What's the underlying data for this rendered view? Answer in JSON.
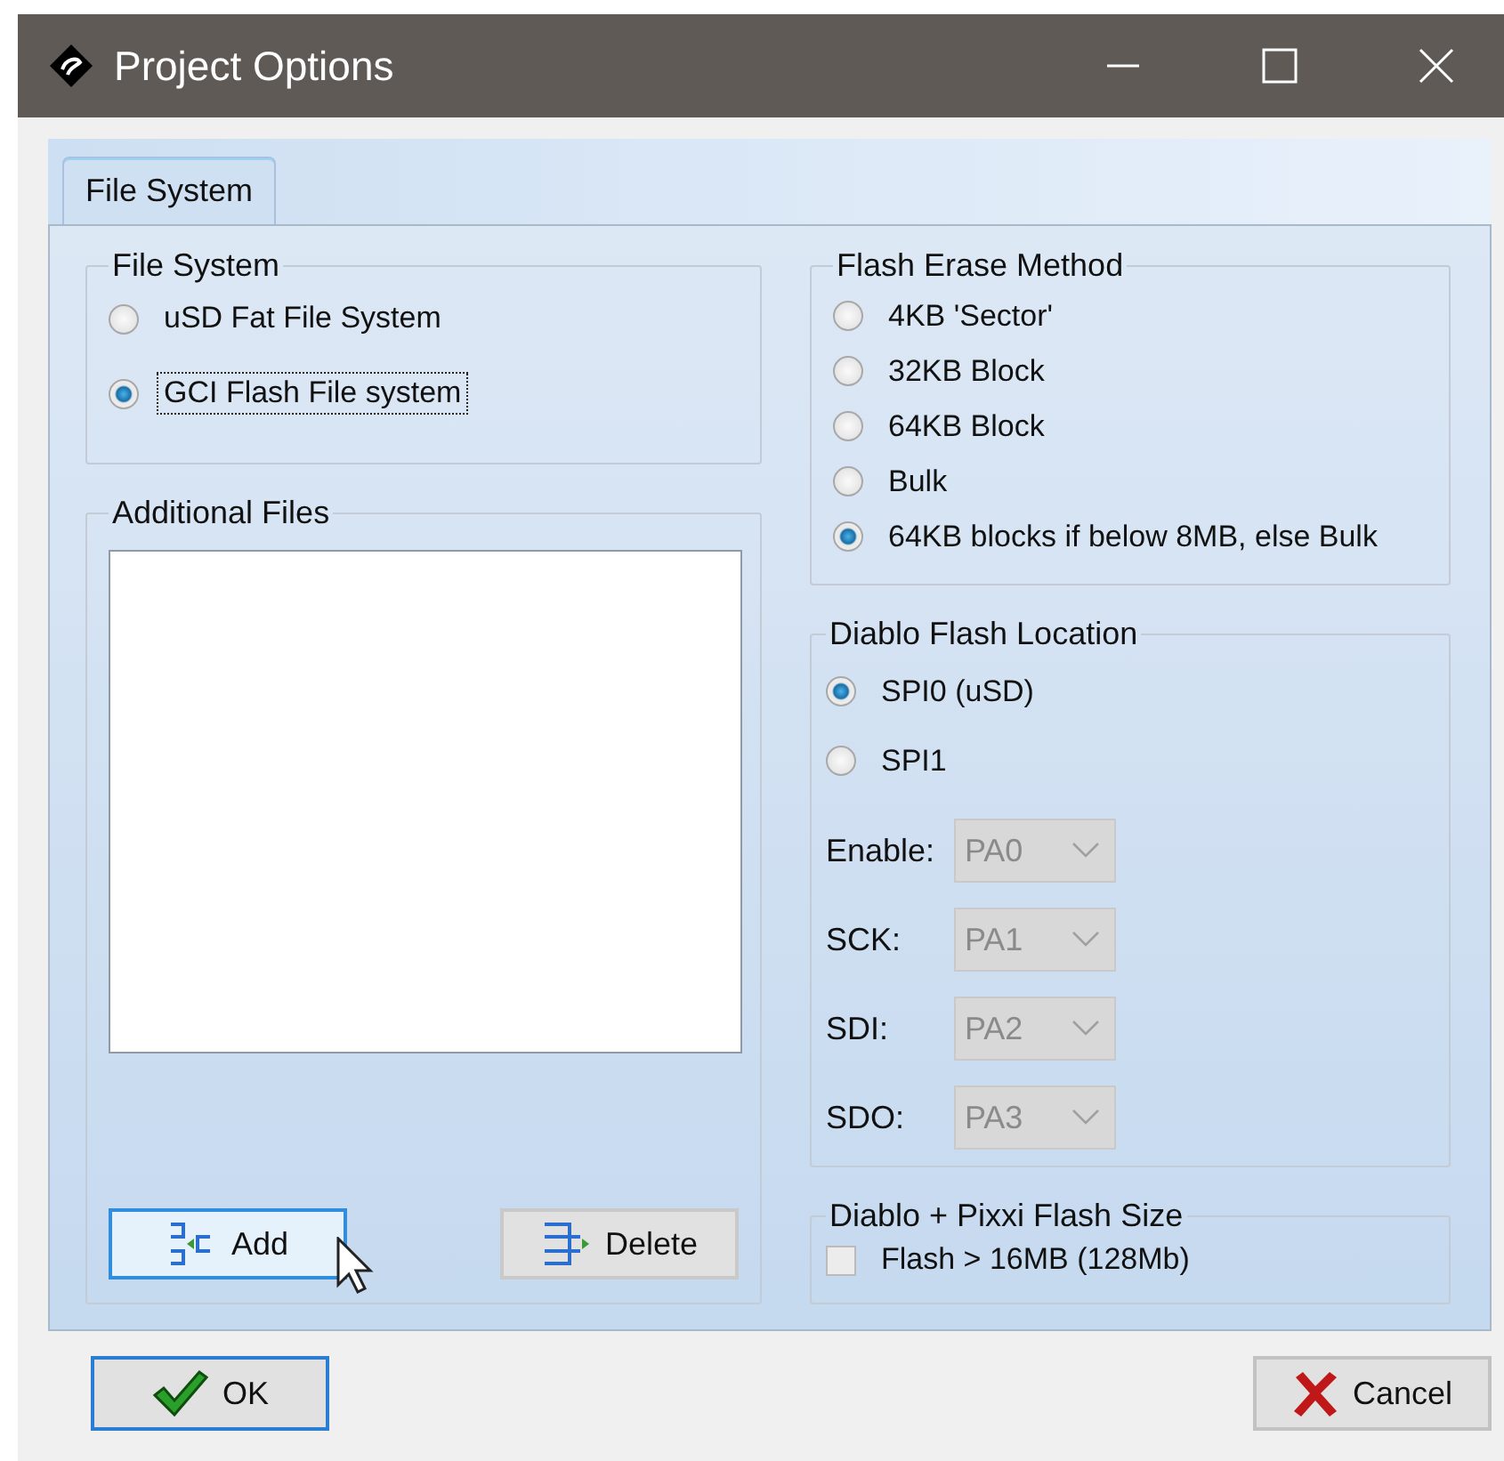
{
  "window": {
    "title": "Project Options"
  },
  "tabs": [
    {
      "label": "File System",
      "selected": true
    }
  ],
  "file_system": {
    "title": "File System",
    "options": [
      {
        "label": "uSD Fat File System",
        "selected": false,
        "focused": false
      },
      {
        "label": "GCI Flash File system",
        "selected": true,
        "focused": true
      }
    ]
  },
  "additional_files": {
    "title": "Additional Files",
    "buttons": [
      {
        "kind": "add",
        "label": "Add",
        "hovered": true
      },
      {
        "kind": "delete",
        "label": "Delete",
        "hovered": false
      }
    ]
  },
  "flash_erase_method": {
    "title": "Flash Erase Method",
    "options": [
      {
        "label": "4KB 'Sector'",
        "selected": false
      },
      {
        "label": "32KB Block",
        "selected": false
      },
      {
        "label": "64KB Block",
        "selected": false
      },
      {
        "label": "Bulk",
        "selected": false
      },
      {
        "label": "64KB blocks if below 8MB, else Bulk",
        "selected": true
      }
    ]
  },
  "diablo_flash_location": {
    "title": "Diablo Flash Location",
    "options": [
      {
        "label": "SPI0 (uSD)",
        "selected": true
      },
      {
        "label": "SPI1",
        "selected": false
      }
    ],
    "pins": [
      {
        "label": "Enable:",
        "value": "PA0",
        "disabled": true
      },
      {
        "label": "SCK:",
        "value": "PA1",
        "disabled": true
      },
      {
        "label": "SDI:",
        "value": "PA2",
        "disabled": true
      },
      {
        "label": "SDO:",
        "value": "PA3",
        "disabled": true
      }
    ]
  },
  "flash_size": {
    "title": "Diablo + Pixxi Flash Size",
    "checkbox": {
      "label": "Flash > 16MB (128Mb)",
      "checked": false
    }
  },
  "footer_buttons": [
    {
      "kind": "ok",
      "label": "OK",
      "default": true
    },
    {
      "kind": "cancel",
      "label": "Cancel",
      "default": false
    }
  ]
}
